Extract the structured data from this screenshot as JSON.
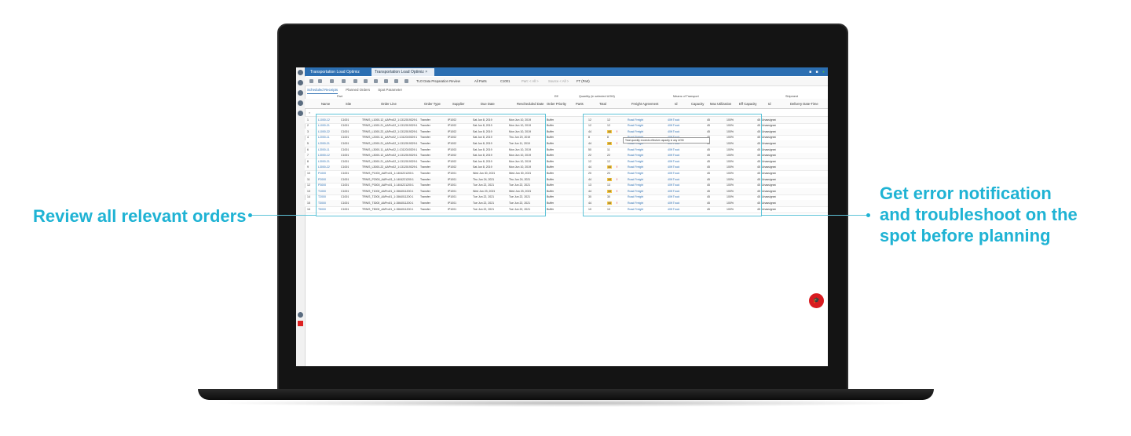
{
  "callouts": {
    "left": "Review all relevant orders",
    "right_line1": "Get error notification",
    "right_line2": "and troubleshoot on the",
    "right_line3": "spot before planning"
  },
  "app": {
    "tabs": [
      "Transportation Load Optimiz",
      "Transportation Load Optimiz"
    ],
    "toolbar": {
      "review_button": "TLO Data Preparation Review",
      "all_parts": "All Parts",
      "scenario": "C1001",
      "part_filter": "Part: < All >",
      "source_filter": "Source < All >",
      "ft_filter": "FT (Part)"
    },
    "subtabs": [
      "Scheduled Receipts",
      "Planned Orders",
      "Spot Parameter"
    ],
    "group_headers": {
      "part": "Part",
      "eff": "Eff",
      "quantity": "Quantity (in selected UOM)",
      "means": "Means of Transport",
      "shipment": "Shipment"
    },
    "columns": [
      "Name",
      "Site",
      "Order Line",
      "Order Type",
      "Supplier",
      "Due Date",
      "Rescheduled Date",
      "Order Priority",
      "Parts",
      "Total",
      "Freight Agreement",
      "Id",
      "Capacity",
      "Max Utilization",
      "Eff Capacity",
      "Id",
      "Delivery Date-Time"
    ],
    "tooltip": "Total quantity exceeds effective capacity in any UOM",
    "fab": "🎓"
  },
  "rows": [
    {
      "n": "1",
      "name": "L1000-12",
      "site": "C1001",
      "line": "TRN/S_L1000-12_AAPro02_1:1312019329:1",
      "type": "Transfer",
      "sup": "IP1002",
      "due": "Sat Jun 8, 2019",
      "res": "Mon Jun 10, 2019",
      "pri": "Buffer",
      "parts": "12",
      "total": "12",
      "warn": false,
      "fa": "Road Freight",
      "mid": "40ft Truck",
      "cap": "45",
      "util": "100%",
      "eff": "45",
      "ship": "Unassigned"
    },
    {
      "n": "2",
      "name": "L1000-21",
      "site": "C1001",
      "line": "TRN/S_L1000-21_AAPro02_1:1312019329:1",
      "type": "Transfer",
      "sup": "IP1002",
      "due": "Sat Jun 8, 2019",
      "res": "Mon Jun 10, 2019",
      "pri": "Buffer",
      "parts": "12",
      "total": "12",
      "warn": false,
      "fa": "Road Freight",
      "mid": "40ft Truck",
      "cap": "45",
      "util": "100%",
      "eff": "45",
      "ship": "Unassigned"
    },
    {
      "n": "3",
      "name": "L1000-22",
      "site": "C1001",
      "line": "TRN/S_L1000-22_AAPro02_1:1312019329:1",
      "type": "Transfer",
      "sup": "IP1002",
      "due": "Sat Jun 8, 2019",
      "res": "Mon Jun 10, 2019",
      "pri": "Buffer",
      "parts": "44",
      "total": "44",
      "warn": true,
      "fa": "Road Freight",
      "mid": "40ft Truck",
      "cap": "45",
      "util": "100%",
      "eff": "45",
      "ship": "Unassigned"
    },
    {
      "n": "4",
      "name": "L2000-11",
      "site": "C1001",
      "line": "TRN/S_L2000-11_AAPro02_1:1312019329:1",
      "type": "Transfer",
      "sup": "IP1002",
      "due": "Sat Jun 8, 2019",
      "res": "Thu Jun 20, 2019",
      "pri": "Buffer",
      "parts": "8",
      "total": "8",
      "warn": false,
      "fa": "Road Freight",
      "mid": "40ft Truck",
      "cap": "45",
      "util": "100%",
      "eff": "45",
      "ship": "Unassigned"
    },
    {
      "n": "5",
      "name": "L2000-21",
      "site": "C1001",
      "line": "TRN/S_L2000-21_AAPro02_1:1312019329:1",
      "type": "Transfer",
      "sup": "IP1002",
      "due": "Sat Jun 8, 2019",
      "res": "Tue Jun 11, 2019",
      "pri": "Buffer",
      "parts": "44",
      "total": "44",
      "warn": true,
      "fa": "Road Freight",
      "mid": "40ft Truck",
      "cap": "45",
      "util": "100%",
      "eff": "45",
      "ship": "Unassigned"
    },
    {
      "n": "6",
      "name": "L3000-11",
      "site": "C1001",
      "line": "TRN/S_L3000-11_AAPro02_1:1312019329:1",
      "type": "Transfer",
      "sup": "IP1003",
      "due": "Sat Jun 8, 2019",
      "res": "Mon Jun 10, 2019",
      "pri": "Buffer",
      "parts": "50",
      "total": "11",
      "warn": false,
      "fa": "Road Freight",
      "mid": "40ft Truck",
      "cap": "45",
      "util": "100%",
      "eff": "45",
      "ship": "Unassigned"
    },
    {
      "n": "7",
      "name": "L3000-12",
      "site": "C1001",
      "line": "TRN/S_L3000-12_AAPro02_1:1312019329:1",
      "type": "Transfer",
      "sup": "IP1002",
      "due": "Sat Jun 8, 2019",
      "res": "Mon Jun 10, 2019",
      "pri": "Buffer",
      "parts": "22",
      "total": "22",
      "warn": false,
      "fa": "Road Freight",
      "mid": "40ft Truck",
      "cap": "45",
      "util": "100%",
      "eff": "45",
      "ship": "Unassigned"
    },
    {
      "n": "8",
      "name": "L3000-21",
      "site": "C1001",
      "line": "TRN/S_L3000-21_AAPro02_1:1312019329:1",
      "type": "Transfer",
      "sup": "IP1002",
      "due": "Sat Jun 8, 2019",
      "res": "Mon Jun 10, 2019",
      "pri": "Buffer",
      "parts": "12",
      "total": "12",
      "warn": false,
      "fa": "Road Freight",
      "mid": "40ft Truck",
      "cap": "45",
      "util": "100%",
      "eff": "45",
      "ship": "Unassigned"
    },
    {
      "n": "9",
      "name": "L3000-22",
      "site": "C1001",
      "line": "TRN/S_L3000-22_AAPro02_1:1312019329:1",
      "type": "Transfer",
      "sup": "IP1002",
      "due": "Sat Jun 8, 2019",
      "res": "Mon Jun 10, 2019",
      "pri": "Buffer",
      "parts": "44",
      "total": "44",
      "warn": true,
      "fa": "Road Freight",
      "mid": "40ft Truck",
      "cap": "45",
      "util": "100%",
      "eff": "45",
      "ship": "Unassigned"
    },
    {
      "n": "10",
      "name": "P1000",
      "site": "C1001",
      "line": "TRN/S_P1000_AAPro01_1:1404221200:1",
      "type": "Transfer",
      "sup": "IP1001",
      "due": "Wed Jun 30, 2021",
      "res": "Wed Jun 30, 2021",
      "pri": "Buffer",
      "parts": "20",
      "total": "20",
      "warn": false,
      "fa": "Road Freight",
      "mid": "40ft Truck",
      "cap": "45",
      "util": "100%",
      "eff": "45",
      "ship": "Unassigned"
    },
    {
      "n": "11",
      "name": "P2000",
      "site": "C1001",
      "line": "TRN/S_P2000_AAPro01_1:1404221200:1",
      "type": "Transfer",
      "sup": "IP1001",
      "due": "Thu Jun 24, 2021",
      "res": "Thu Jun 24, 2021",
      "pri": "Buffer",
      "parts": "44",
      "total": "44",
      "warn": true,
      "fa": "Road Freight",
      "mid": "40ft Truck",
      "cap": "45",
      "util": "100%",
      "eff": "45",
      "ship": "Unassigned"
    },
    {
      "n": "12",
      "name": "P3000",
      "site": "C1001",
      "line": "TRN/S_P3000_AAPro01_1:1404221200:1",
      "type": "Transfer",
      "sup": "IP1001",
      "due": "Tue Jun 22, 2021",
      "res": "Tue Jun 22, 2021",
      "pri": "Buffer",
      "parts": "13",
      "total": "13",
      "warn": false,
      "fa": "Road Freight",
      "mid": "40ft Truck",
      "cap": "45",
      "util": "100%",
      "eff": "45",
      "ship": "Unassigned"
    },
    {
      "n": "13",
      "name": "T1000",
      "site": "C1001",
      "line": "TRN/S_T1000_AAPro01_1:1564011200:1",
      "type": "Transfer",
      "sup": "IP1001",
      "due": "Wed Jun 23, 2021",
      "res": "Wed Jun 23, 2021",
      "pri": "Buffer",
      "parts": "44",
      "total": "44",
      "warn": true,
      "fa": "Road Freight",
      "mid": "40ft Truck",
      "cap": "45",
      "util": "100%",
      "eff": "45",
      "ship": "Unassigned"
    },
    {
      "n": "14",
      "name": "T2000",
      "site": "C1001",
      "line": "TRN/S_T2000_AAPro01_1:1564011200:1",
      "type": "Transfer",
      "sup": "IP1001",
      "due": "Tue Jun 22, 2021",
      "res": "Tue Jun 22, 2021",
      "pri": "Buffer",
      "parts": "30",
      "total": "30",
      "warn": false,
      "fa": "Road Freight",
      "mid": "40ft Truck",
      "cap": "45",
      "util": "100%",
      "eff": "45",
      "ship": "Unassigned"
    },
    {
      "n": "15",
      "name": "T3000",
      "site": "C1001",
      "line": "TRN/S_T3000_AAPro01_1:1564011200:1",
      "type": "Transfer",
      "sup": "IP1001",
      "due": "Tue Jun 22, 2021",
      "res": "Tue Jun 22, 2021",
      "pri": "Buffer",
      "parts": "44",
      "total": "44",
      "warn": true,
      "fa": "Road Freight",
      "mid": "40ft Truck",
      "cap": "45",
      "util": "100%",
      "eff": "45",
      "ship": "Unassigned"
    },
    {
      "n": "16",
      "name": "T5000",
      "site": "C1001",
      "line": "TRN/S_T5000_AAPro01_1:1564011200:1",
      "type": "Transfer",
      "sup": "IP1001",
      "due": "Tue Jun 22, 2021",
      "res": "Tue Jun 22, 2021",
      "pri": "Buffer",
      "parts": "10",
      "total": "10",
      "warn": false,
      "fa": "Road Freight",
      "mid": "40ft Truck",
      "cap": "45",
      "util": "100%",
      "eff": "45",
      "ship": "Unassigned"
    }
  ]
}
